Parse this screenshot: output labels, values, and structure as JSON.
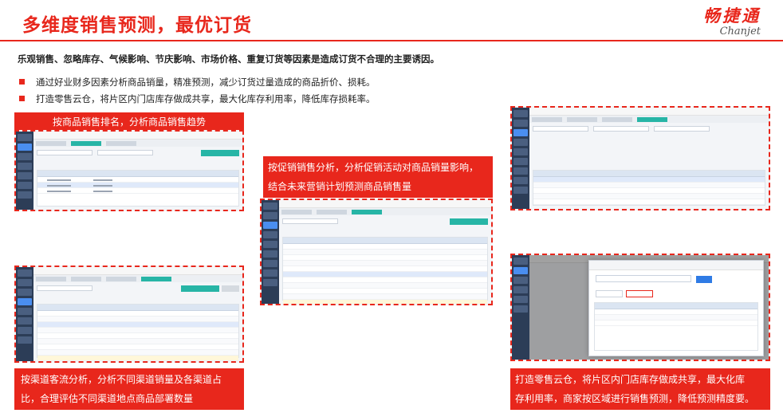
{
  "header": {
    "title": "多维度销售预测，最优订货",
    "logo_cn": "畅捷通",
    "logo_en": "Chanjet"
  },
  "intro": "乐观销售、忽略库存、气候影响、节庆影响、市场价格、重复订货等因素是造成订货不合理的主要诱因。",
  "bullets": [
    "通过好业财多因素分析商品销量，精准预测，减少订货过量造成的商品折价、损耗。",
    "打造零售云仓，将片区内门店库存做成共享，最大化库存利用率，降低库存损耗率。"
  ],
  "callouts": {
    "product_ranking": "按商品销售排名，分析商品销售趋势",
    "promo_line1": "按促销销售分析，分析促销活动对商品销量影响，",
    "promo_line2": "结合未来营销计划预测商品销售量",
    "channel_line1": "按渠道客流分析，分析不同渠道销量及各渠道占",
    "channel_line2": "比，合理评估不同渠道地点商品部署数量",
    "cloud_line1": "打造零售云仓，将片区内门店库存做成共享，最大化库",
    "cloud_line2": "存利用率，商家按区域进行销售预测，降低预测精度要。"
  },
  "colors": {
    "accent": "#e8271c",
    "nav": "#2c3d57",
    "teal": "#27b5a6",
    "blue": "#2f7be5"
  }
}
